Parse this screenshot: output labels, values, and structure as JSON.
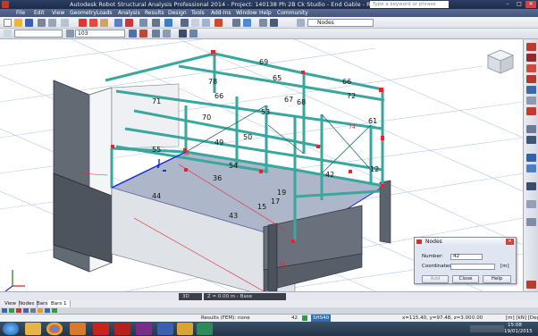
{
  "app": {
    "title": "Autodesk Robot Structural Analysis Professional 2014 - Project: 140138 Ph 2B Ck Studio - End Gable - Results (FEM): none",
    "search_placeholder": "Type a keyword or phrase"
  },
  "menu": [
    "File",
    "Edit",
    "View",
    "Geometry",
    "Loads",
    "Analysis",
    "Results",
    "Design",
    "Tools",
    "Add-Ins",
    "Window",
    "Help",
    "Community"
  ],
  "toolbar": {
    "selection_combo": "103",
    "view_combo": "Nodes"
  },
  "model_labels": {
    "members": [
      "69",
      "65",
      "78",
      "66",
      "71",
      "67",
      "68",
      "72",
      "66",
      "53",
      "70",
      "61",
      "55",
      "50",
      "49",
      "54",
      "42",
      "36",
      "19",
      "17",
      "44",
      "43",
      "15",
      "12",
      "74",
      "14"
    ],
    "nodes": [
      "65",
      "56"
    ]
  },
  "viewport_bar": {
    "view": "3D",
    "plane": "Z = 0.00 m - Base"
  },
  "bottom_tabs": [
    "View",
    "Nodes",
    "Bars",
    "Bars 1"
  ],
  "nodes_dialog": {
    "title": "Nodes",
    "number_label": "Number:",
    "number_value": "42",
    "coordinates_label": "Coordinates:",
    "coordinates_value": "",
    "unit": "[m]",
    "add_label": "Add",
    "close_label": "Close",
    "help_label": "Help"
  },
  "status": {
    "results": "Results (FEM): none",
    "count": "42",
    "section": "SHS40",
    "coords": "x=115.40, y=97.48, z=3.00",
    "value": "0.00",
    "units": "[m] [kN] [Deg]"
  },
  "clock": {
    "time": "15:08",
    "date": "19/01/2015"
  },
  "colors": {
    "steel": "#3aa79e",
    "steel_dark": "#1f6d66",
    "slab": "#aeb6c9",
    "wall": "#5f6670",
    "node": "#e8232b",
    "selection": "#1a2fd6"
  }
}
